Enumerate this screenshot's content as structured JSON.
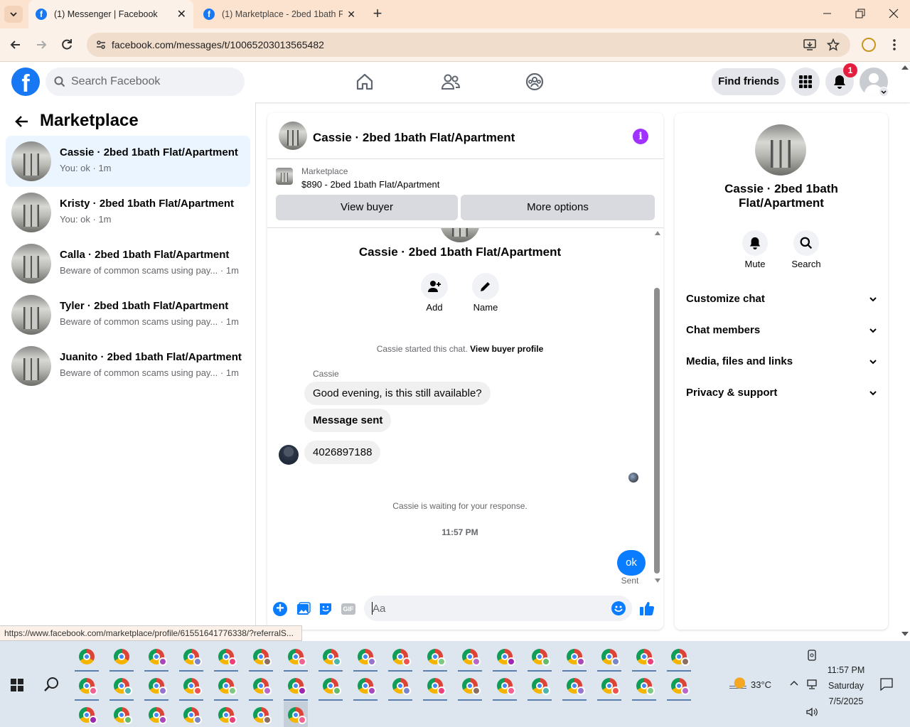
{
  "browser": {
    "tabs": [
      {
        "label": "(1) Messenger | Facebook",
        "active": true
      },
      {
        "label": "(1) Marketplace - 2bed 1bath Fl",
        "active": false
      }
    ],
    "url": "facebook.com/messages/t/10065203013565482",
    "status_url": "https://www.facebook.com/marketplace/profile/61551641776338/?referralS..."
  },
  "fb": {
    "search_placeholder": "Search Facebook",
    "find_friends": "Find friends",
    "notif_count": "1"
  },
  "sidebar": {
    "title": "Marketplace",
    "items": [
      {
        "name": "Cassie · 2bed 1bath Flat/Apartment",
        "sub": "You: ok · 1m",
        "selected": true
      },
      {
        "name": "Kristy · 2bed 1bath Flat/Apartment",
        "sub": "You: ok · 1m",
        "selected": false
      },
      {
        "name": "Calla · 2bed 1bath Flat/Apartment",
        "sub": "Beware of common scams using pay... · 1m",
        "selected": false
      },
      {
        "name": "Tyler · 2bed 1bath Flat/Apartment",
        "sub": "Beware of common scams using pay... · 1m",
        "selected": false
      },
      {
        "name": "Juanito · 2bed 1bath Flat/Apartment",
        "sub": "Beware of common scams using pay... · 1m",
        "selected": false
      }
    ]
  },
  "chat": {
    "title": "Cassie · 2bed 1bath Flat/Apartment",
    "listing_source": "Marketplace",
    "listing_title": "$890 - 2bed 1bath Flat/Apartment",
    "view_buyer": "View buyer",
    "more_options": "More options",
    "profile_name": "Cassie · 2bed 1bath Flat/Apartment",
    "add_label": "Add",
    "name_label": "Name",
    "started_text": "Cassie started this chat.",
    "view_buyer_profile": "View buyer profile",
    "sender": "Cassie",
    "messages": [
      "Good evening, is this still available?",
      "Message sent",
      "4026897188"
    ],
    "waiting": "Cassie is waiting for your response.",
    "time": "11:57 PM",
    "my_message": "ok",
    "sent_label": "Sent",
    "input_placeholder": "Aa"
  },
  "details": {
    "name_line1": "Cassie · 2bed 1bath",
    "name_line2": "Flat/Apartment",
    "mute": "Mute",
    "search": "Search",
    "sections": [
      "Customize chat",
      "Chat members",
      "Media, files and links",
      "Privacy & support"
    ]
  },
  "taskbar": {
    "temperature": "33°C",
    "time": "11:57 PM",
    "day": "Saturday",
    "date": "7/5/2025"
  },
  "colors": {
    "fb_blue": "#1877f2",
    "messenger_purple": "#a033ff",
    "notif_red": "#e41e3f"
  }
}
